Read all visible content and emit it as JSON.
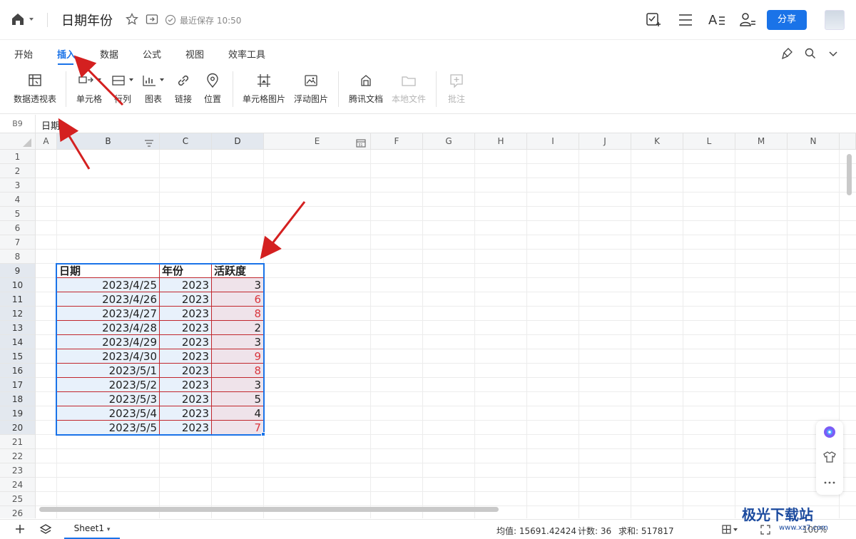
{
  "app": {
    "doc_title": "日期年份",
    "saved_status": "最近保存 10:50",
    "share_label": "分享"
  },
  "tabs": [
    {
      "label": "开始"
    },
    {
      "label": "插入"
    },
    {
      "label": "数据"
    },
    {
      "label": "公式"
    },
    {
      "label": "视图"
    },
    {
      "label": "效率工具"
    }
  ],
  "ribbon": {
    "pivot": "数据透视表",
    "cell": "单元格",
    "rowcol": "行列",
    "chart": "图表",
    "link": "链接",
    "location": "位置",
    "cell_image": "单元格图片",
    "float_image": "浮动图片",
    "tencent_doc": "腾讯文档",
    "local_file": "本地文件",
    "comment": "批注"
  },
  "formula_bar": {
    "cell_ref": "B9",
    "content": "日期"
  },
  "columns": [
    "A",
    "B",
    "C",
    "D",
    "E",
    "F",
    "G",
    "H",
    "I",
    "J",
    "K",
    "L",
    "M",
    "N"
  ],
  "rows": [
    "1",
    "2",
    "3",
    "4",
    "5",
    "6",
    "7",
    "8",
    "9",
    "10",
    "11",
    "12",
    "13",
    "14",
    "15",
    "16",
    "17",
    "18",
    "19",
    "20",
    "21",
    "22",
    "23",
    "24",
    "25",
    "26"
  ],
  "table": {
    "headers": [
      "日期",
      "年份",
      "活跃度"
    ],
    "rows": [
      {
        "date": "2023/4/25",
        "year": "2023",
        "activity": "3",
        "highlight": false
      },
      {
        "date": "2023/4/26",
        "year": "2023",
        "activity": "6",
        "highlight": true
      },
      {
        "date": "2023/4/27",
        "year": "2023",
        "activity": "8",
        "highlight": true
      },
      {
        "date": "2023/4/28",
        "year": "2023",
        "activity": "2",
        "highlight": false
      },
      {
        "date": "2023/4/29",
        "year": "2023",
        "activity": "3",
        "highlight": false
      },
      {
        "date": "2023/4/30",
        "year": "2023",
        "activity": "9",
        "highlight": true
      },
      {
        "date": "2023/5/1",
        "year": "2023",
        "activity": "8",
        "highlight": true
      },
      {
        "date": "2023/5/2",
        "year": "2023",
        "activity": "3",
        "highlight": false
      },
      {
        "date": "2023/5/3",
        "year": "2023",
        "activity": "5",
        "highlight": false
      },
      {
        "date": "2023/5/4",
        "year": "2023",
        "activity": "4",
        "highlight": false
      },
      {
        "date": "2023/5/5",
        "year": "2023",
        "activity": "7",
        "highlight": true
      }
    ]
  },
  "status": {
    "sheet_name": "Sheet1",
    "average": "均值: 15691.42424",
    "count": "计数: 36",
    "sum": "求和: 517817",
    "zoom": "100%"
  },
  "watermark": {
    "title": "极光下载站",
    "url": "www.xz7.com"
  },
  "colors": {
    "accent": "#1a73e8",
    "highlight_text": "#d9363e",
    "table_border": "#c1272d",
    "annotation_arrow": "#d42020"
  }
}
